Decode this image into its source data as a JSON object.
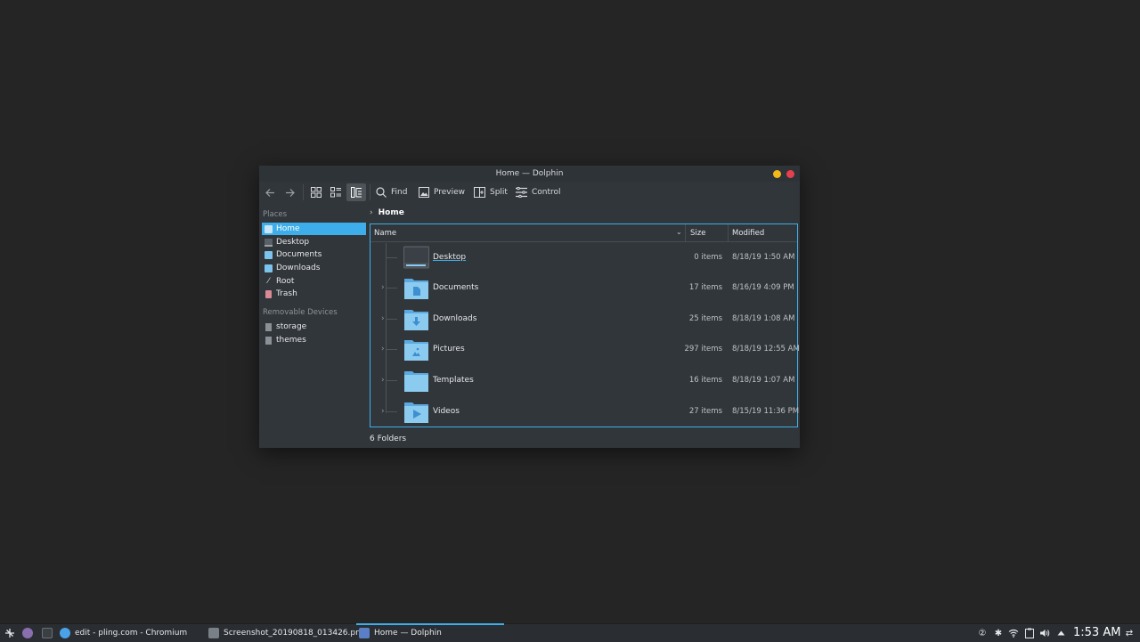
{
  "window": {
    "title": "Home — Dolphin"
  },
  "toolbar": {
    "find_label": "Find",
    "preview_label": "Preview",
    "split_label": "Split",
    "control_label": "Control"
  },
  "sidebar": {
    "places_title": "Places",
    "places": [
      {
        "label": "Home",
        "icon": "home-icon",
        "selected": true
      },
      {
        "label": "Desktop",
        "icon": "desktop-icon"
      },
      {
        "label": "Documents",
        "icon": "documents-icon"
      },
      {
        "label": "Downloads",
        "icon": "downloads-icon"
      },
      {
        "label": "Root",
        "icon": "root-icon"
      },
      {
        "label": "Trash",
        "icon": "trash-icon"
      }
    ],
    "removable_title": "Removable Devices",
    "devices": [
      {
        "label": "storage",
        "icon": "drive-icon"
      },
      {
        "label": "themes",
        "icon": "drive-icon"
      }
    ]
  },
  "breadcrumb": {
    "current": "Home"
  },
  "columns": {
    "name": "Name",
    "size": "Size",
    "modified": "Modified"
  },
  "files": [
    {
      "name": "Desktop",
      "size": "0 items",
      "modified": "8/18/19 1:50 AM",
      "icon": "desktop-folder-icon"
    },
    {
      "name": "Documents",
      "size": "17 items",
      "modified": "8/16/19 4:09 PM",
      "icon": "documents-folder-icon"
    },
    {
      "name": "Downloads",
      "size": "25 items",
      "modified": "8/18/19 1:08 AM",
      "icon": "downloads-folder-icon"
    },
    {
      "name": "Pictures",
      "size": "297 items",
      "modified": "8/18/19 12:55 AM",
      "icon": "pictures-folder-icon"
    },
    {
      "name": "Templates",
      "size": "16 items",
      "modified": "8/18/19 1:07 AM",
      "icon": "templates-folder-icon"
    },
    {
      "name": "Videos",
      "size": "27 items",
      "modified": "8/15/19 11:36 PM",
      "icon": "videos-folder-icon"
    }
  ],
  "status": {
    "text": "6 Folders"
  },
  "taskbar": {
    "tasks": [
      {
        "label": "edit - pling.com - Chromium"
      },
      {
        "label": "Screenshot_20190818_013426.pn..."
      },
      {
        "label": "Home — Dolphin"
      }
    ],
    "clock": "1:53 AM"
  },
  "colors": {
    "accent": "#3daee9",
    "window_bg": "#31363b",
    "desktop_bg": "#252526",
    "minimize": "#f4b818",
    "close": "#e6404e"
  }
}
